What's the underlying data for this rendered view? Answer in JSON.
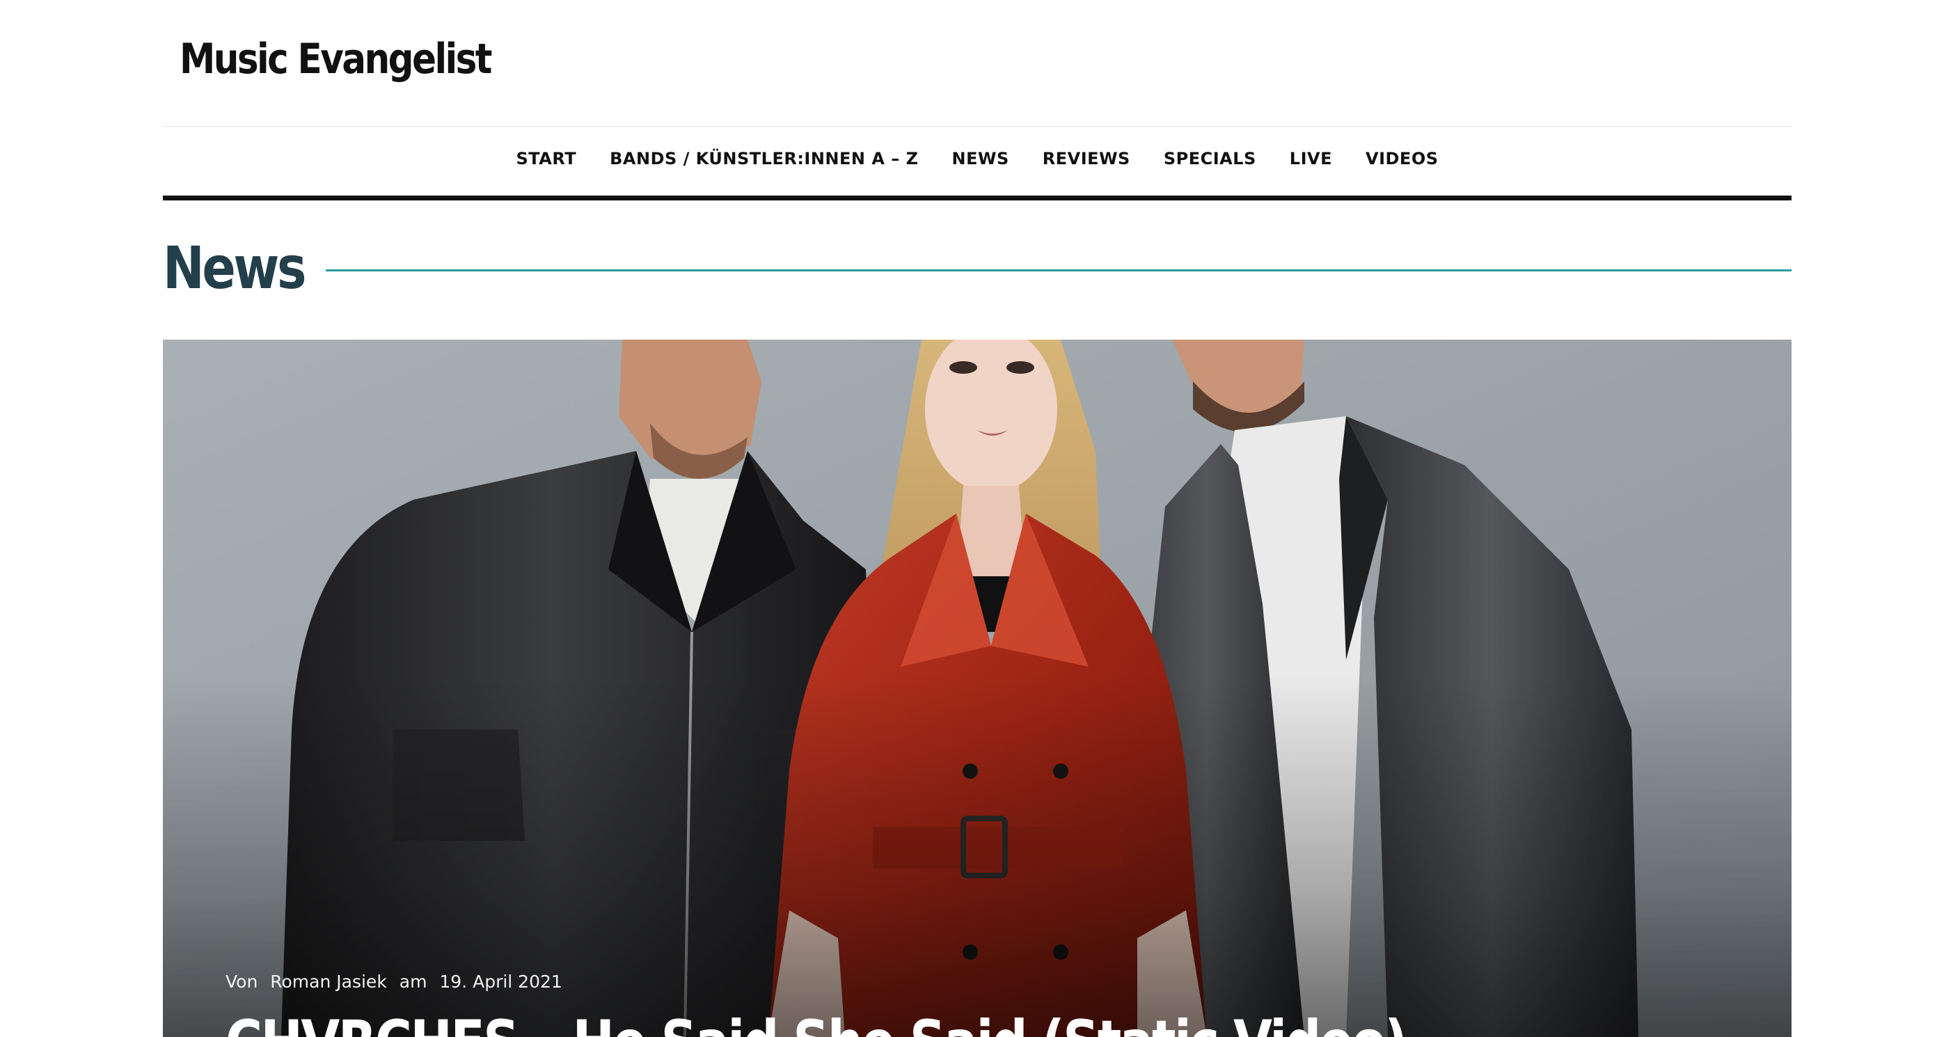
{
  "site": {
    "title": "Music Evangelist"
  },
  "nav": {
    "items": [
      {
        "label": "START"
      },
      {
        "label": "BANDS / KÜNSTLER:INNEN A – Z"
      },
      {
        "label": "NEWS"
      },
      {
        "label": "REVIEWS"
      },
      {
        "label": "SPECIALS"
      },
      {
        "label": "LIVE"
      },
      {
        "label": "VIDEOS"
      }
    ]
  },
  "section": {
    "title": "News"
  },
  "featured": {
    "by_label": "Von",
    "author": "Roman Jasiek",
    "date_label": "am",
    "date": "19. April 2021",
    "title": "CHVRCHES – He Said She Said (Static Video)"
  },
  "colors": {
    "section_title": "#233f4c",
    "section_rule": "#2a9a9e",
    "nav_underline": "#111111"
  }
}
